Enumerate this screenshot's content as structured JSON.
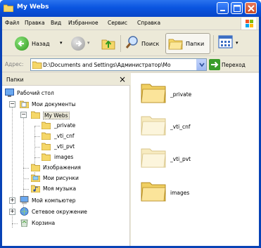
{
  "window": {
    "title": "My Webs",
    "colors": {
      "title_bar": "#0a55e0",
      "chrome": "#ece9d8",
      "close": "#c84a27"
    }
  },
  "menu": {
    "items": [
      "Файл",
      "Правка",
      "Вид",
      "Избранное",
      "Сервис",
      "Справка"
    ]
  },
  "toolbar": {
    "back_label": "Назад",
    "search_label": "Поиск",
    "folders_label": "Папки"
  },
  "address": {
    "label": "Адрес:",
    "value": "D:\\Documents and Settings\\Администратор\\Мо",
    "go_label": "Переход"
  },
  "folders_pane": {
    "title": "Папки",
    "close": "×",
    "tree": [
      {
        "label": "Рабочий стол",
        "icon": "desktop-icon"
      },
      {
        "label": "Мои документы",
        "icon": "my-documents-icon",
        "expander": "−"
      },
      {
        "label": "My Webs",
        "icon": "folder-open-icon",
        "expander": "−",
        "selected": true
      },
      {
        "label": "_private",
        "icon": "folder-icon"
      },
      {
        "label": "_vti_cnf",
        "icon": "folder-icon"
      },
      {
        "label": "_vti_pvt",
        "icon": "folder-icon"
      },
      {
        "label": "images",
        "icon": "folder-icon"
      },
      {
        "label": "Изображения",
        "icon": "folder-icon"
      },
      {
        "label": "Мои рисунки",
        "icon": "my-pictures-icon"
      },
      {
        "label": "Моя музыка",
        "icon": "my-music-icon"
      },
      {
        "label": "Мой компьютер",
        "icon": "my-computer-icon",
        "expander": "+"
      },
      {
        "label": "Сетевое окружение",
        "icon": "network-icon",
        "expander": "+"
      },
      {
        "label": "Корзина",
        "icon": "recycle-bin-icon"
      }
    ]
  },
  "content": {
    "items": [
      {
        "label": "_private",
        "icon": "folder-icon"
      },
      {
        "label": "_vti_cnf",
        "icon": "folder-hidden-icon"
      },
      {
        "label": "_vti_pvt",
        "icon": "folder-hidden-icon"
      },
      {
        "label": "images",
        "icon": "folder-icon"
      }
    ]
  }
}
